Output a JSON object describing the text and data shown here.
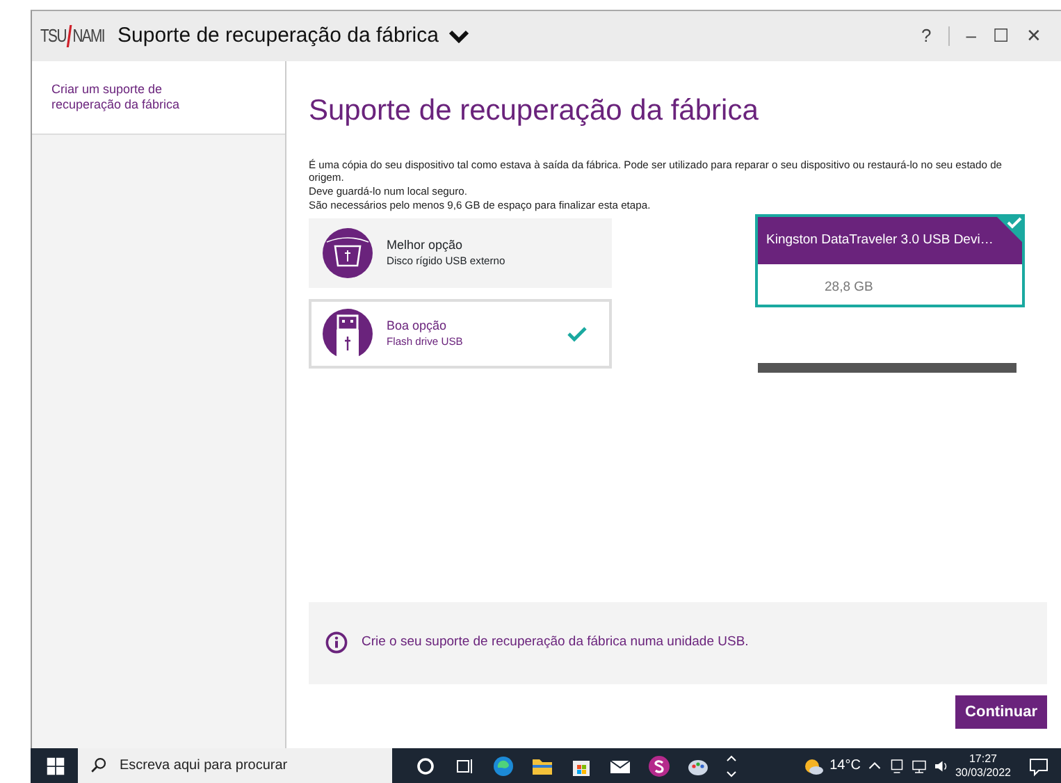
{
  "window": {
    "logo": {
      "left": "TSU",
      "right": "NAMI"
    },
    "title": "Suporte de recuperação da fábrica",
    "controls": [
      "?",
      "–",
      "☐",
      "✕"
    ]
  },
  "sidebar": {
    "items": [
      {
        "label": "Criar um suporte de recuperação da fábrica",
        "selected": true
      }
    ]
  },
  "main": {
    "heading": "Suporte de recuperação da fábrica",
    "description": [
      "É uma cópia do seu dispositivo tal como estava à saída da fábrica. Pode ser utilizado para reparar o seu dispositivo ou restaurá-lo no seu estado de origem.",
      "Deve guardá-lo num local seguro.",
      "São necessários pelo menos 9,6 GB de espaço para finalizar esta etapa."
    ],
    "options": [
      {
        "kind": "hdd",
        "title": "Melhor opção",
        "subtitle": "Disco rígido USB externo",
        "selected": false
      },
      {
        "kind": "flash",
        "title": "Boa opção",
        "subtitle": "Flash drive USB",
        "selected": true
      }
    ],
    "devices": [
      {
        "name": "Kingston DataTraveler 3.0 USB Devi…",
        "size": "28,8 GB",
        "selected": true
      }
    ],
    "info": "Crie o seu suporte de recuperação da fábrica numa unidade USB.",
    "continue_button": "Continuar"
  },
  "taskbar": {
    "search_placeholder": "Escreva aqui para procurar",
    "temperature": "14°C",
    "time": "17:27",
    "date": "30/03/2022"
  }
}
